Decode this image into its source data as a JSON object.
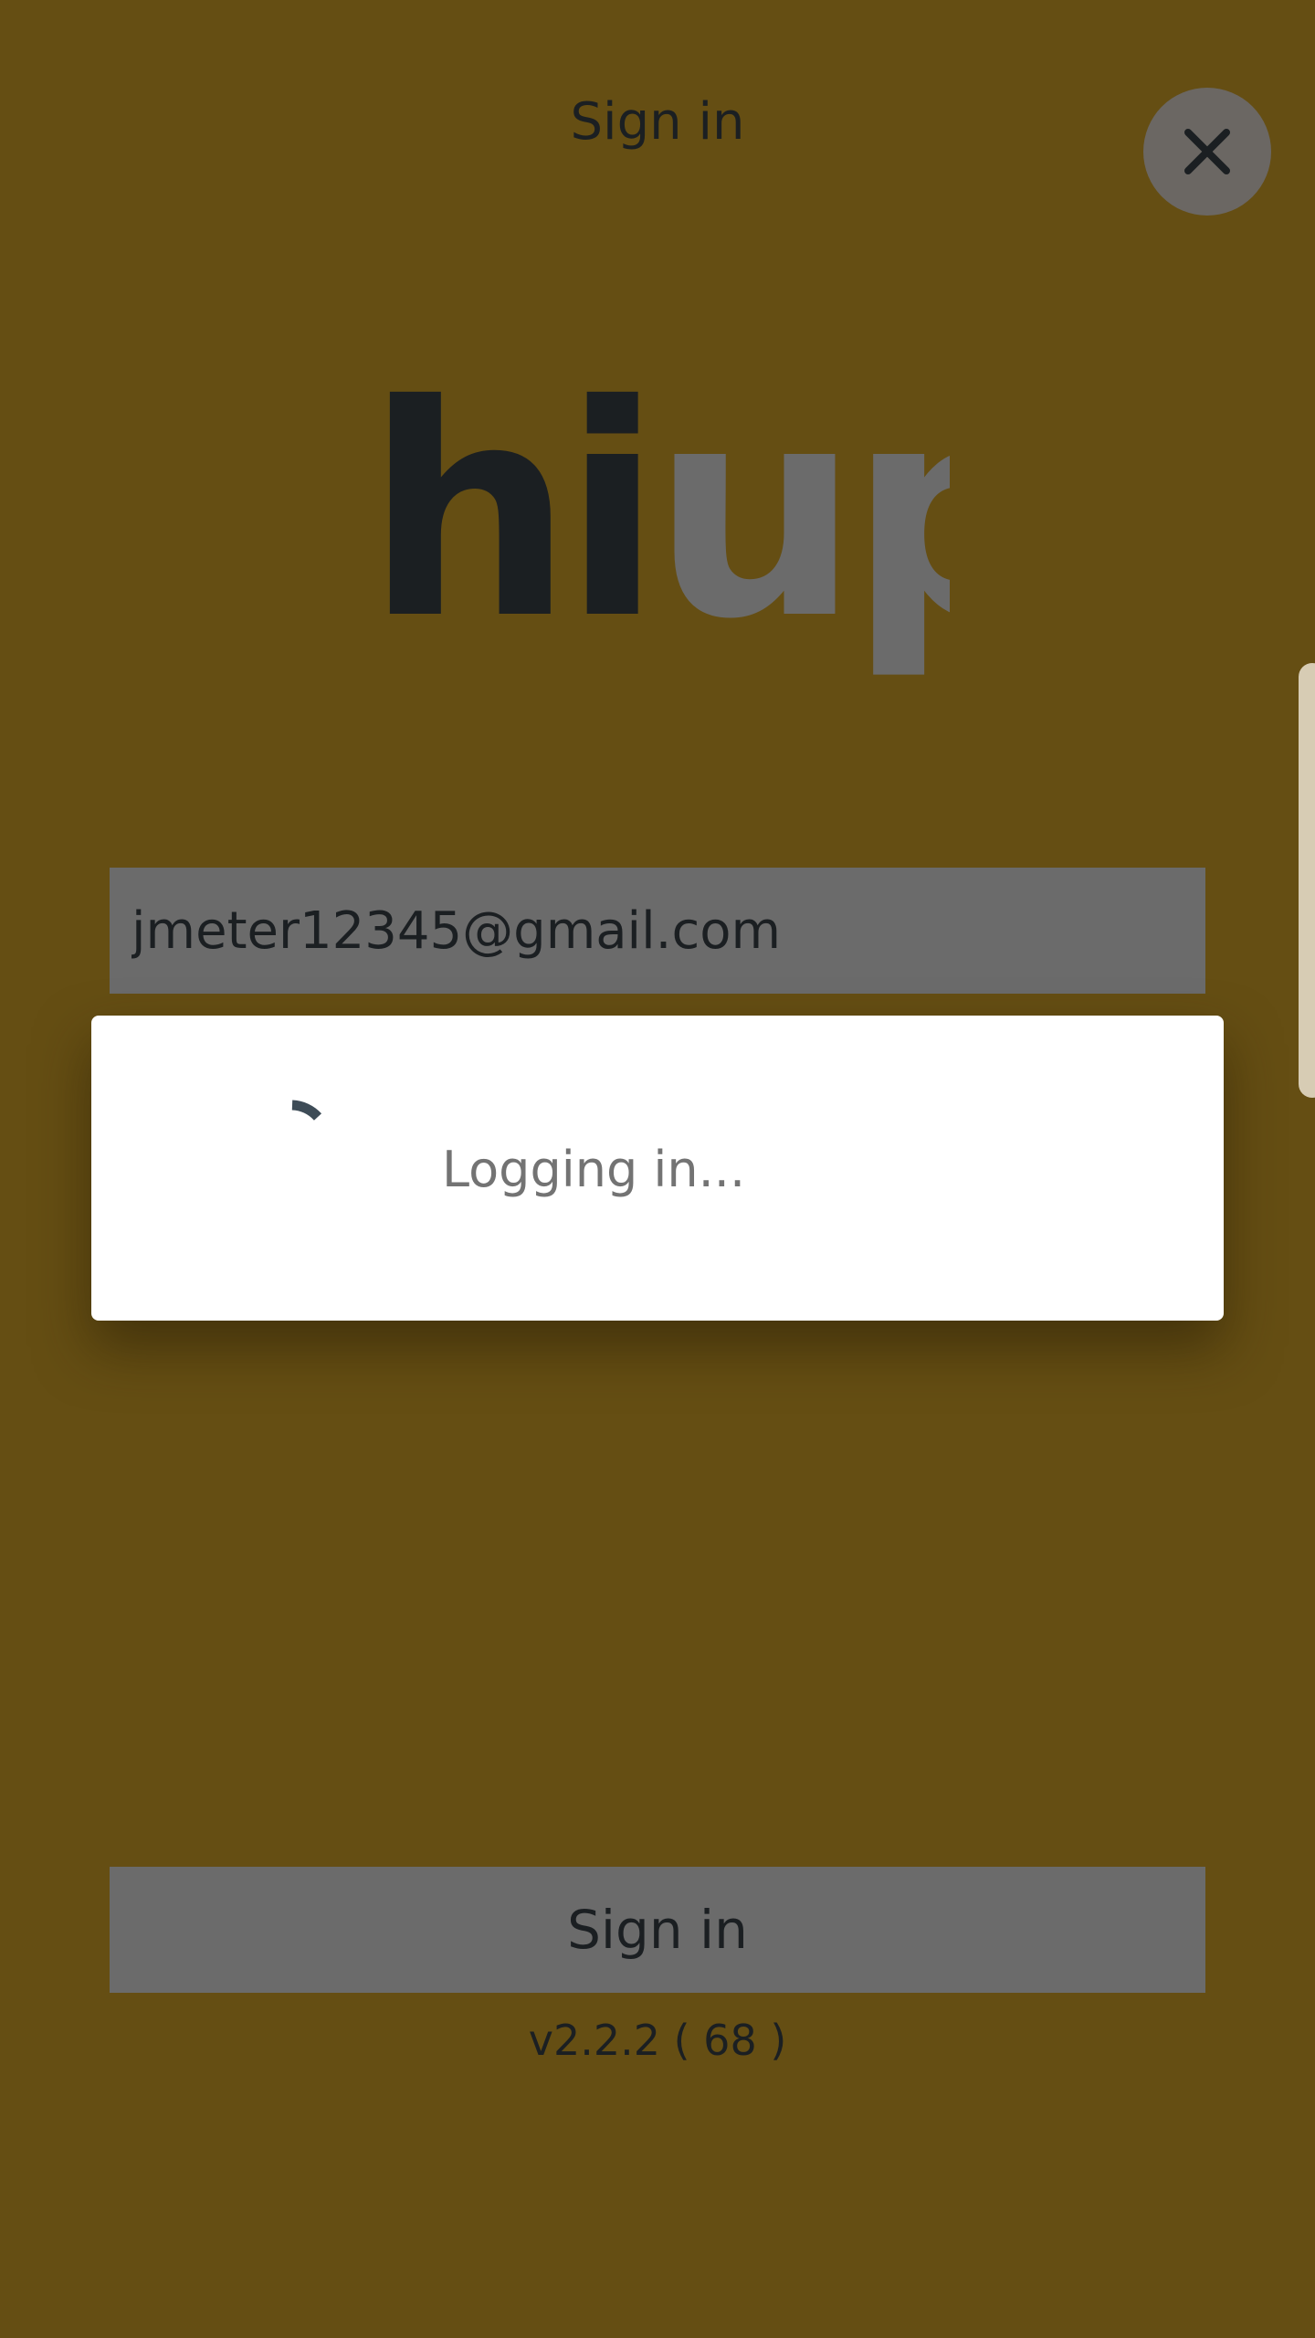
{
  "header": {
    "title": "Sign in",
    "close_icon": "close-icon"
  },
  "logo": {
    "part_dark": "hi",
    "part_light": "up",
    "colors": {
      "dark": "#1b1f22",
      "light": "#6b6b6b"
    }
  },
  "form": {
    "email_value": "jmeter12345@gmail.com",
    "submit_label": "Sign in"
  },
  "dialog": {
    "spinner_icon": "loading-spinner-icon",
    "message": "Logging in..."
  },
  "footer": {
    "version": "v2.2.2 ( 68 )"
  },
  "colors": {
    "background_overlay": "#654e13",
    "field_background": "#6b6b6b",
    "dialog_background": "#ffffff",
    "spinner": "#3e4c57"
  }
}
